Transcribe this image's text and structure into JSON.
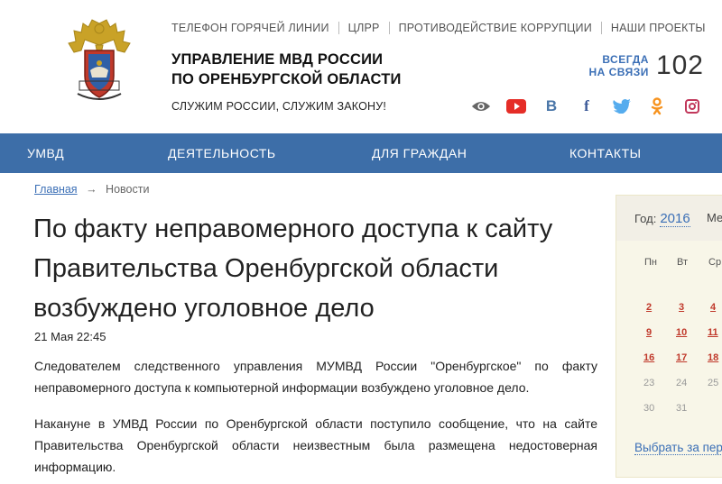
{
  "header": {
    "top_links": [
      "ТЕЛЕФОН ГОРЯЧЕЙ ЛИНИИ",
      "ЦЛРР",
      "ПРОТИВОДЕЙСТВИЕ КОРРУПЦИИ",
      "НАШИ ПРОЕКТЫ"
    ],
    "brand_line1": "УПРАВЛЕНИЕ МВД РОССИИ",
    "brand_line2": "ПО ОРЕНБУРГСКОЙ ОБЛАСТИ",
    "slogan": "СЛУЖИМ РОССИИ, СЛУЖИМ ЗАКОНУ!",
    "hotline_line1": "ВСЕГДА",
    "hotline_line2": "НА СВЯЗИ",
    "hotline_number": "102",
    "social_icons": [
      "eye-icon",
      "youtube-icon",
      "vk-icon",
      "facebook-icon",
      "twitter-icon",
      "odnoklassniki-icon",
      "instagram-icon"
    ]
  },
  "nav": {
    "items": [
      "УМВД",
      "ДЕЯТЕЛЬНОСТЬ",
      "ДЛЯ ГРАЖДАН",
      "КОНТАКТЫ"
    ]
  },
  "breadcrumb": {
    "home": "Главная",
    "separator": "→",
    "current": "Новости"
  },
  "article": {
    "title": "По факту неправомерного доступа к сайту Правительства Оренбургской области возбуждено уголовное дело",
    "date": "21 Мая 22:45",
    "paragraphs": [
      "Следователем следственного управления МУМВД России \"Оренбургское\" по факту неправомерного доступа к компьютерной информации возбуждено уголовное дело.",
      "Накануне в УМВД России по Оренбургской области поступило сообщение, что на сайте Правительства Оренбургской области неизвестным  была размещена недостоверная информацию."
    ]
  },
  "calendar": {
    "year_label": "Год:",
    "year": "2016",
    "month_label_partial": "Ме",
    "weekdays": [
      "Пн",
      "Вт",
      "Ср"
    ],
    "rows": [
      [
        "2",
        "3",
        "4"
      ],
      [
        "9",
        "10",
        "11"
      ],
      [
        "16",
        "17",
        "18"
      ],
      [
        "23",
        "24",
        "25"
      ],
      [
        "30",
        "31",
        ""
      ]
    ],
    "link_days": [
      "2",
      "3",
      "4",
      "9",
      "10",
      "11",
      "16",
      "17",
      "18"
    ],
    "pick_label": "Выбрать за пер"
  },
  "colors": {
    "nav_bg": "#3d6ea8",
    "link": "#3b6fb6",
    "cal_bg": "#f8f6e8",
    "day_link": "#c0392b"
  }
}
